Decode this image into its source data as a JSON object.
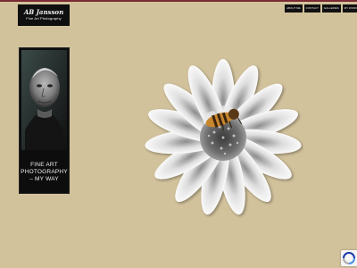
{
  "header": {
    "logo_name": "AB Jansson",
    "logo_tagline": "Fine Art Photography"
  },
  "nav": {
    "items": [
      {
        "label": "ABOUT ME"
      },
      {
        "label": "CONTACT"
      },
      {
        "label": "GALLERIES"
      },
      {
        "label": "MY WORK INFO"
      }
    ]
  },
  "sidebar": {
    "tagline": "FINE ART PHOTOGRAPHY – MY WAY"
  },
  "colors": {
    "page_background": "#d2c29c",
    "header_rule": "#7a2a33",
    "panel_background": "#0d0d0d"
  },
  "icons": {
    "recaptcha": "recaptcha-icon"
  }
}
